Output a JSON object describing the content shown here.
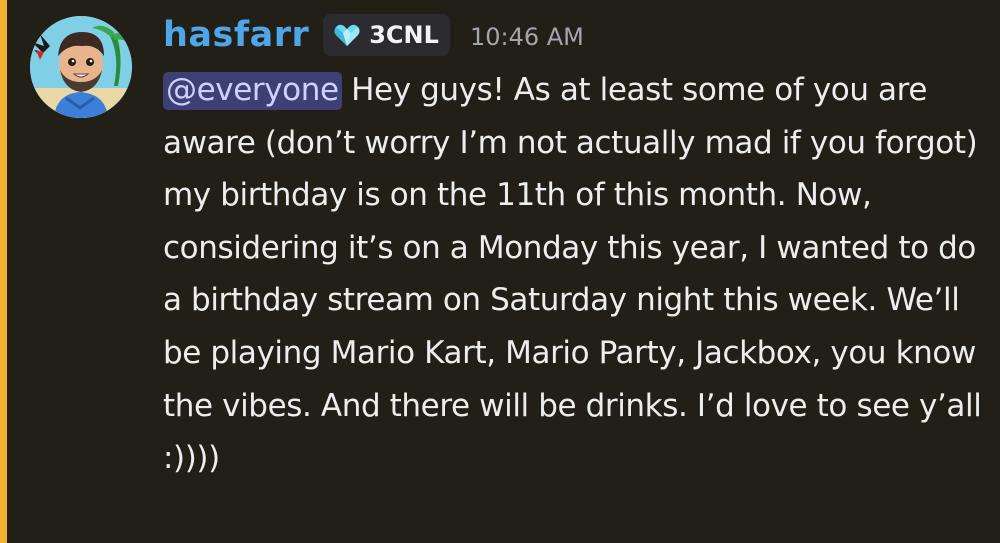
{
  "colors": {
    "highlight_bar": "#f0b232",
    "message_background": "#221f17",
    "username": "#4ea6e8",
    "mention_background": "#3e4075",
    "mention_text": "#ced2ff",
    "tag_background": "#2c2b30",
    "tag_icon": "#6ad8f2"
  },
  "message": {
    "author": {
      "name": "hasfarr",
      "avatar_icon": "cartoon-avatar-icon",
      "tag": {
        "icon": "diamond-heart-icon",
        "label": "3CNL"
      }
    },
    "timestamp": "10:46 AM",
    "mention": "@everyone",
    "text": " Hey guys! As at least some of you are aware (don’t worry I’m not actually mad if you forgot) my birthday is on the 11th of this month. Now, considering it’s on a Monday this year, I wanted to do a birthday stream on Saturday night this week. We’ll be playing Mario Kart, Mario Party, Jackbox, you know the vibes. And there will be drinks. I’d love to see y’all :))))"
  }
}
